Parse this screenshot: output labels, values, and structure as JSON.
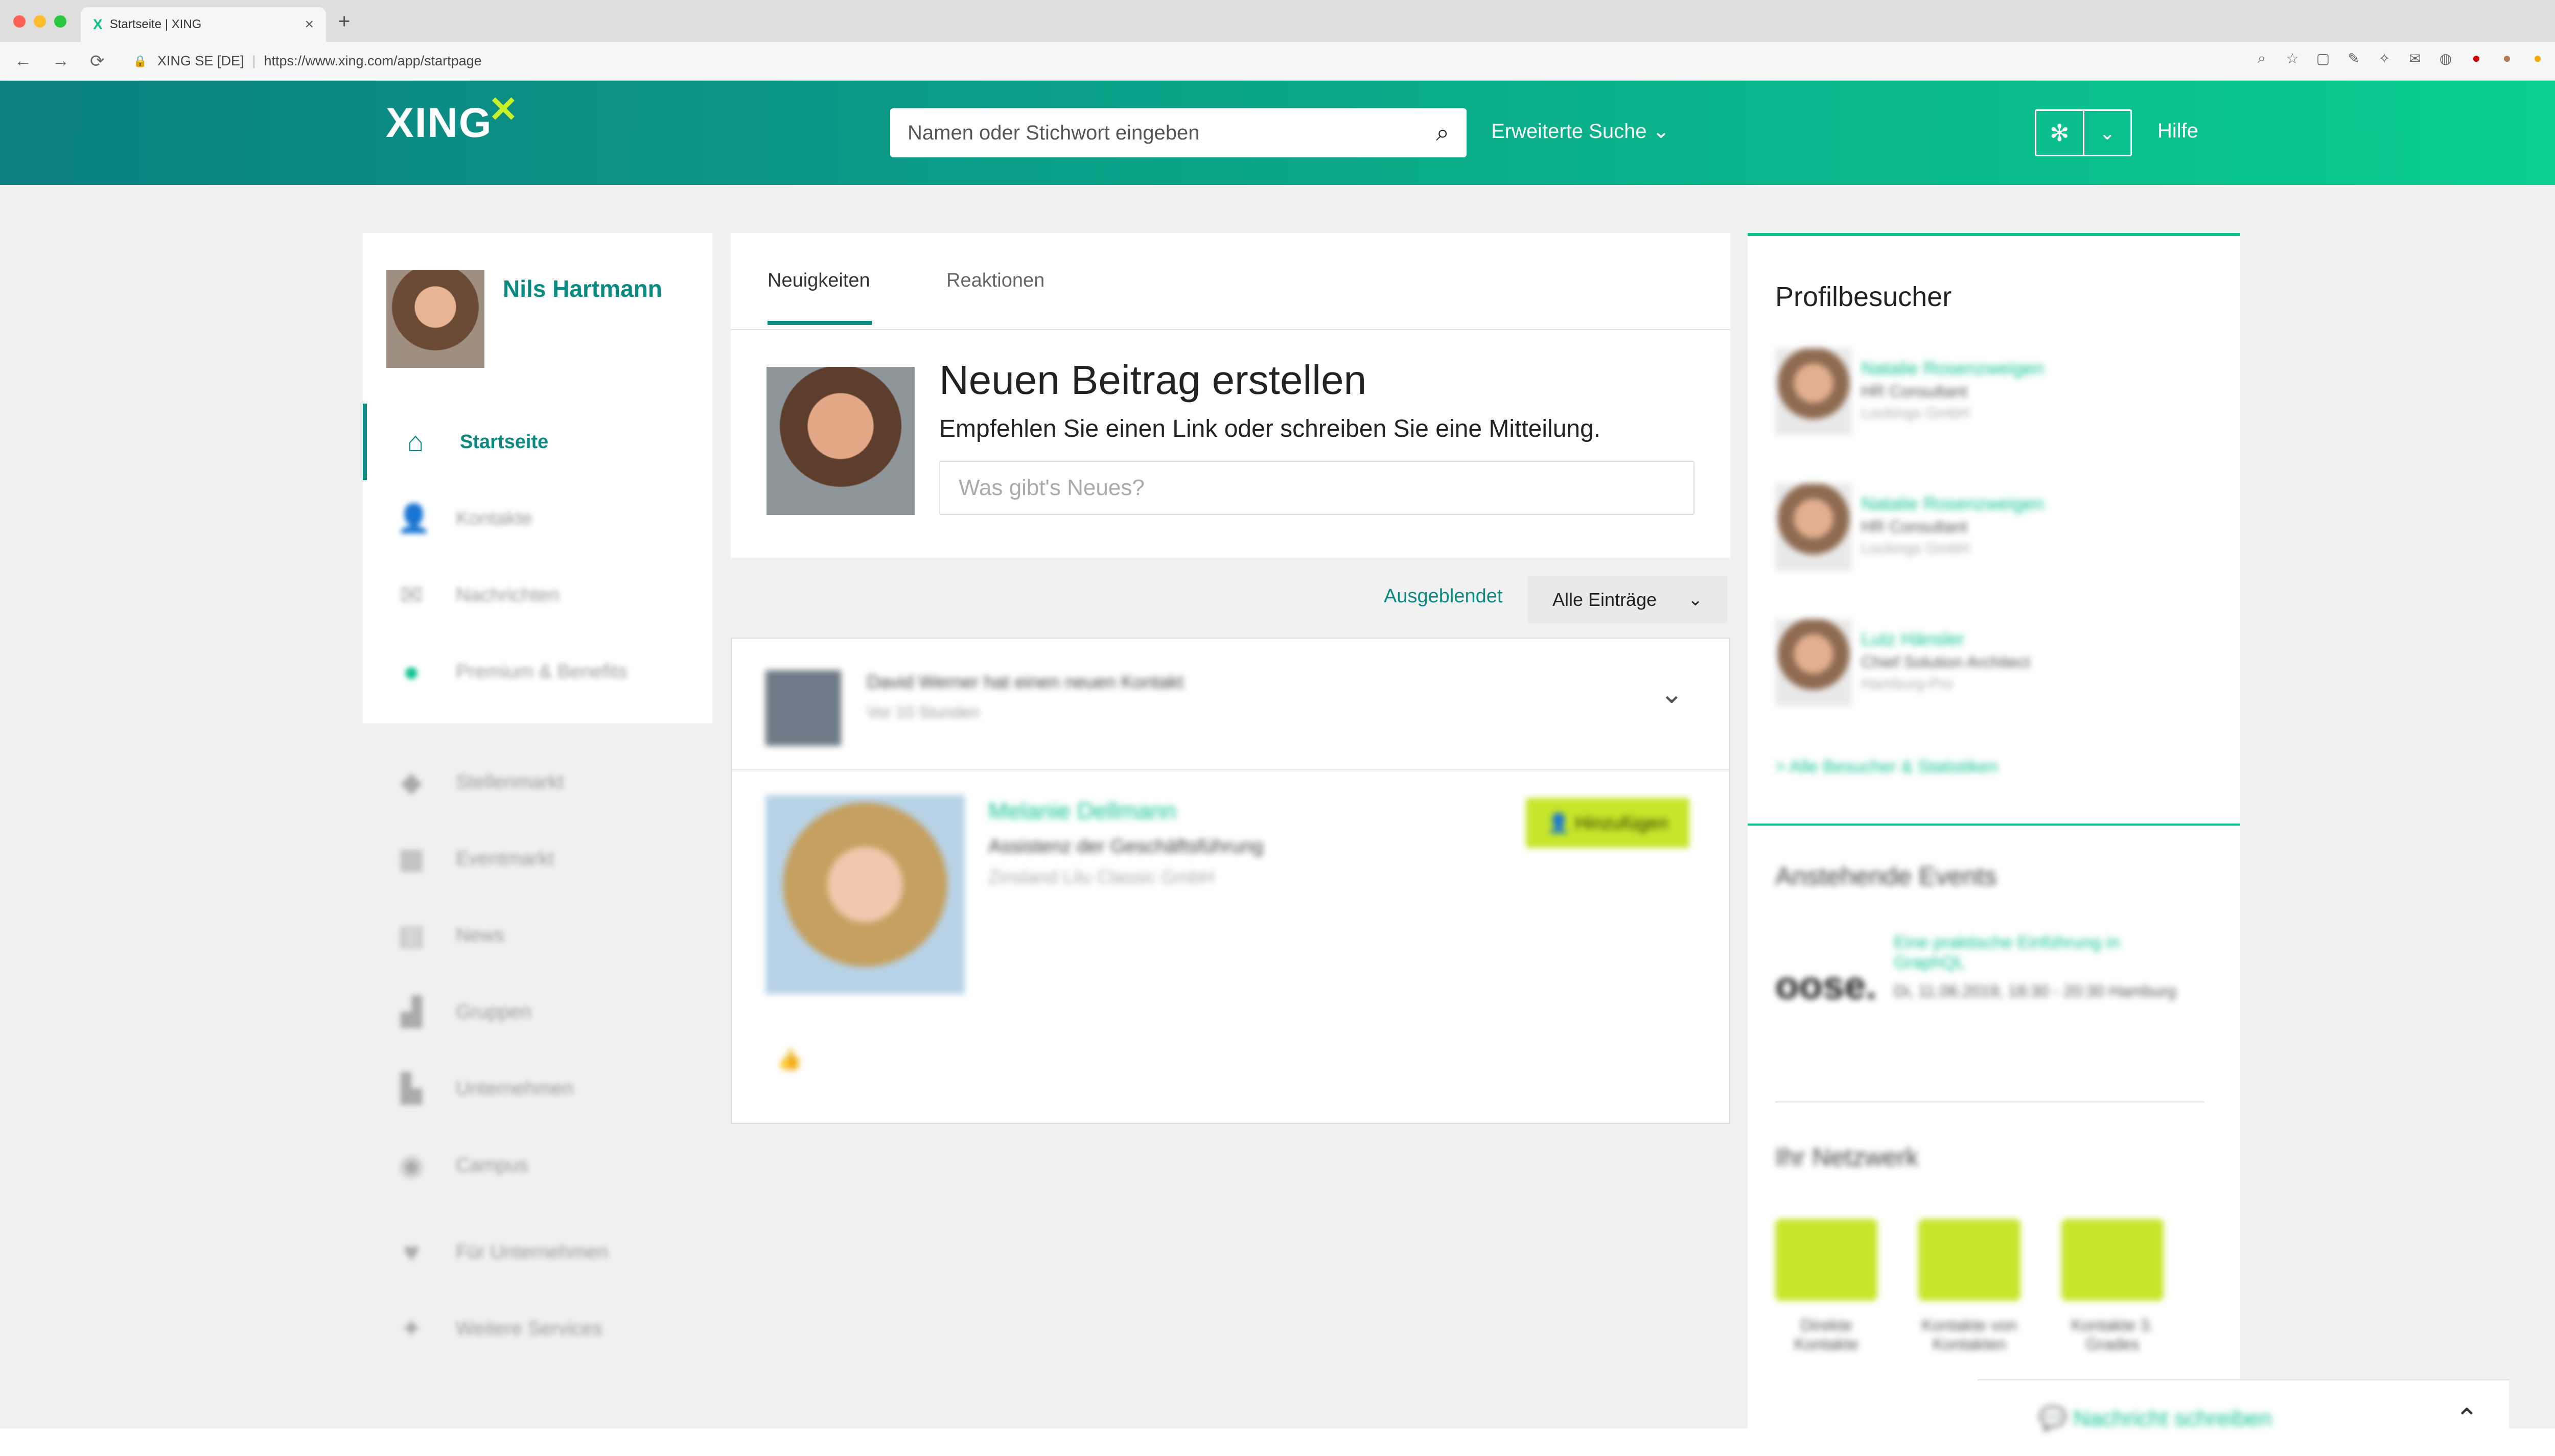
{
  "browser": {
    "tab_title": "Startseite | XING",
    "tab_favicon": "X",
    "tab_close": "×",
    "new_tab": "+",
    "nav": {
      "back": "←",
      "forward": "→",
      "reload": "⟳"
    },
    "lock": "🔒",
    "site_org": "XING SE [DE]",
    "url": "https://www.xing.com/app/startpage",
    "toolbar_icons": [
      "zoom-icon",
      "star-icon",
      "extension-icon",
      "pen-icon",
      "sparkle-icon",
      "mail-icon",
      "shield-icon",
      "record-icon",
      "avatar-icon",
      "coin-icon"
    ]
  },
  "header": {
    "logo": "XING",
    "logo_mark": "✕",
    "search_placeholder": "Namen oder Stichwort eingeben",
    "search_icon": "⌕",
    "advanced_search": "Erweiterte Suche ⌄",
    "settings_icon": "✻",
    "settings_chevron": "⌄",
    "help": "Hilfe"
  },
  "sidebar": {
    "name": "Nils Hartmann",
    "items": [
      {
        "label": "Startseite",
        "icon": "⌂"
      },
      {
        "label": "Kontakte",
        "icon": "👤"
      },
      {
        "label": "Nachrichten",
        "icon": "✉"
      },
      {
        "label": "Premium & Benefits",
        "icon": "●"
      },
      {
        "label": "Stellenmarkt",
        "icon": "◆"
      },
      {
        "label": "Eventmarkt",
        "icon": "▦"
      },
      {
        "label": "News",
        "icon": "▤"
      },
      {
        "label": "Gruppen",
        "icon": "▟"
      },
      {
        "label": "Unternehmen",
        "icon": "▙"
      },
      {
        "label": "Campus",
        "icon": "◉"
      },
      {
        "label": "Für Unternehmen",
        "icon": "♥"
      },
      {
        "label": "Weitere Services",
        "icon": "✦"
      }
    ]
  },
  "feed": {
    "tabs": [
      "Neuigkeiten",
      "Reaktionen"
    ],
    "post_title": "Neuen Beitrag erstellen",
    "post_sub": "Empfehlen Sie einen Link oder schreiben Sie eine Mitteilung.",
    "post_placeholder": "Was gibt's Neues?",
    "filter_hidden": "Ausgeblendet",
    "filter_select": "Alle Einträge",
    "select_chevron": "⌄",
    "item_head": "David Werner hat einen neuen Kontakt",
    "item_time": "Vor 10 Stunden",
    "item_chevron": "⌄",
    "contact_name": "Melanie Dellmann",
    "contact_title": "Assistenz der Geschäftsführung",
    "contact_company": "Zinsland Lilu Classic GmbH",
    "add_button": "👤 Hinzufügen",
    "like": "👍"
  },
  "right": {
    "visitors_title": "Profilbesucher",
    "visitors": [
      {
        "name": "Natalie Rosenzweigen",
        "title": "HR Consultant",
        "company": "Lockings GmbH"
      },
      {
        "name": "Natalie Rosenzweigen",
        "title": "HR Consultant",
        "company": "Lockings GmbH"
      },
      {
        "name": "Lutz Hänsler",
        "title": "Chief Solution Architect",
        "company": "Hamburg-Pro"
      }
    ],
    "all_visitors": "> Alle Besucher & Statistiken",
    "events_title": "Anstehende Events",
    "event_logo": "oose.",
    "event_title": "Eine praktische Einführung in GraphQL",
    "event_meta": "Di, 11.06.2019, 18:30 - 20:30 Hamburg",
    "network_title": "Ihr Netzwerk",
    "network": [
      {
        "label": "Direkte Kontakte"
      },
      {
        "label": "Kontakte von Kontakten"
      },
      {
        "label": "Kontakte 3. Grades"
      }
    ],
    "message_bar": "💬 Nachricht schreiben",
    "message_up": "⌃"
  }
}
